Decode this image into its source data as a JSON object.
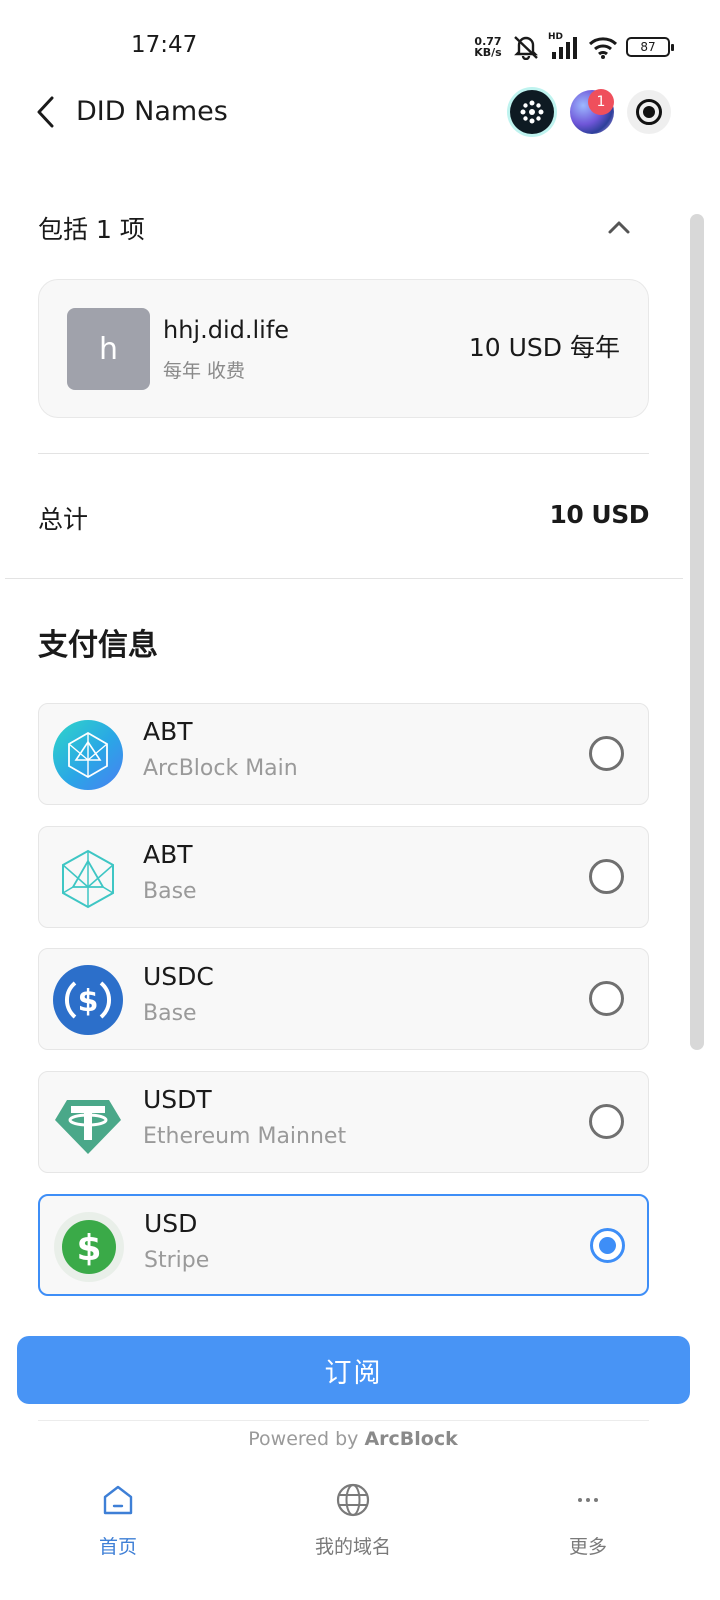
{
  "status_bar": {
    "time": "17:47",
    "net_speed_value": "0.77",
    "net_speed_unit": "KB/s",
    "signal_label": "HD",
    "battery": "87"
  },
  "header": {
    "title": "DID Names",
    "notification_count": "1"
  },
  "order": {
    "section_title": "包括 1 项",
    "item": {
      "avatar_letter": "h",
      "name": "hhj.did.life",
      "billing": "每年 收费",
      "price": "10 USD 每年"
    },
    "total_label": "总计",
    "total_value": "10 USD"
  },
  "payment": {
    "title": "支付信息",
    "options": [
      {
        "currency": "ABT",
        "network": "ArcBlock Main",
        "icon": "arcblock-main-icon",
        "selected": false
      },
      {
        "currency": "ABT",
        "network": "Base",
        "icon": "arcblock-base-icon",
        "selected": false
      },
      {
        "currency": "USDC",
        "network": "Base",
        "icon": "usdc-icon",
        "selected": false
      },
      {
        "currency": "USDT",
        "network": "Ethereum Mainnet",
        "icon": "tether-icon",
        "selected": false
      },
      {
        "currency": "USD",
        "network": "Stripe",
        "icon": "dollar-icon",
        "selected": true
      }
    ],
    "accent_color": "#3e8ef7"
  },
  "subscribe_label": "订阅",
  "powered_by": {
    "prefix": "Powered by",
    "brand": "ArcBlock"
  },
  "bottom_nav": {
    "items": [
      {
        "label": "首页",
        "icon": "home-icon",
        "active": true
      },
      {
        "label": "我的域名",
        "icon": "globe-icon",
        "active": false
      },
      {
        "label": "更多",
        "icon": "more-icon",
        "active": false
      }
    ]
  }
}
